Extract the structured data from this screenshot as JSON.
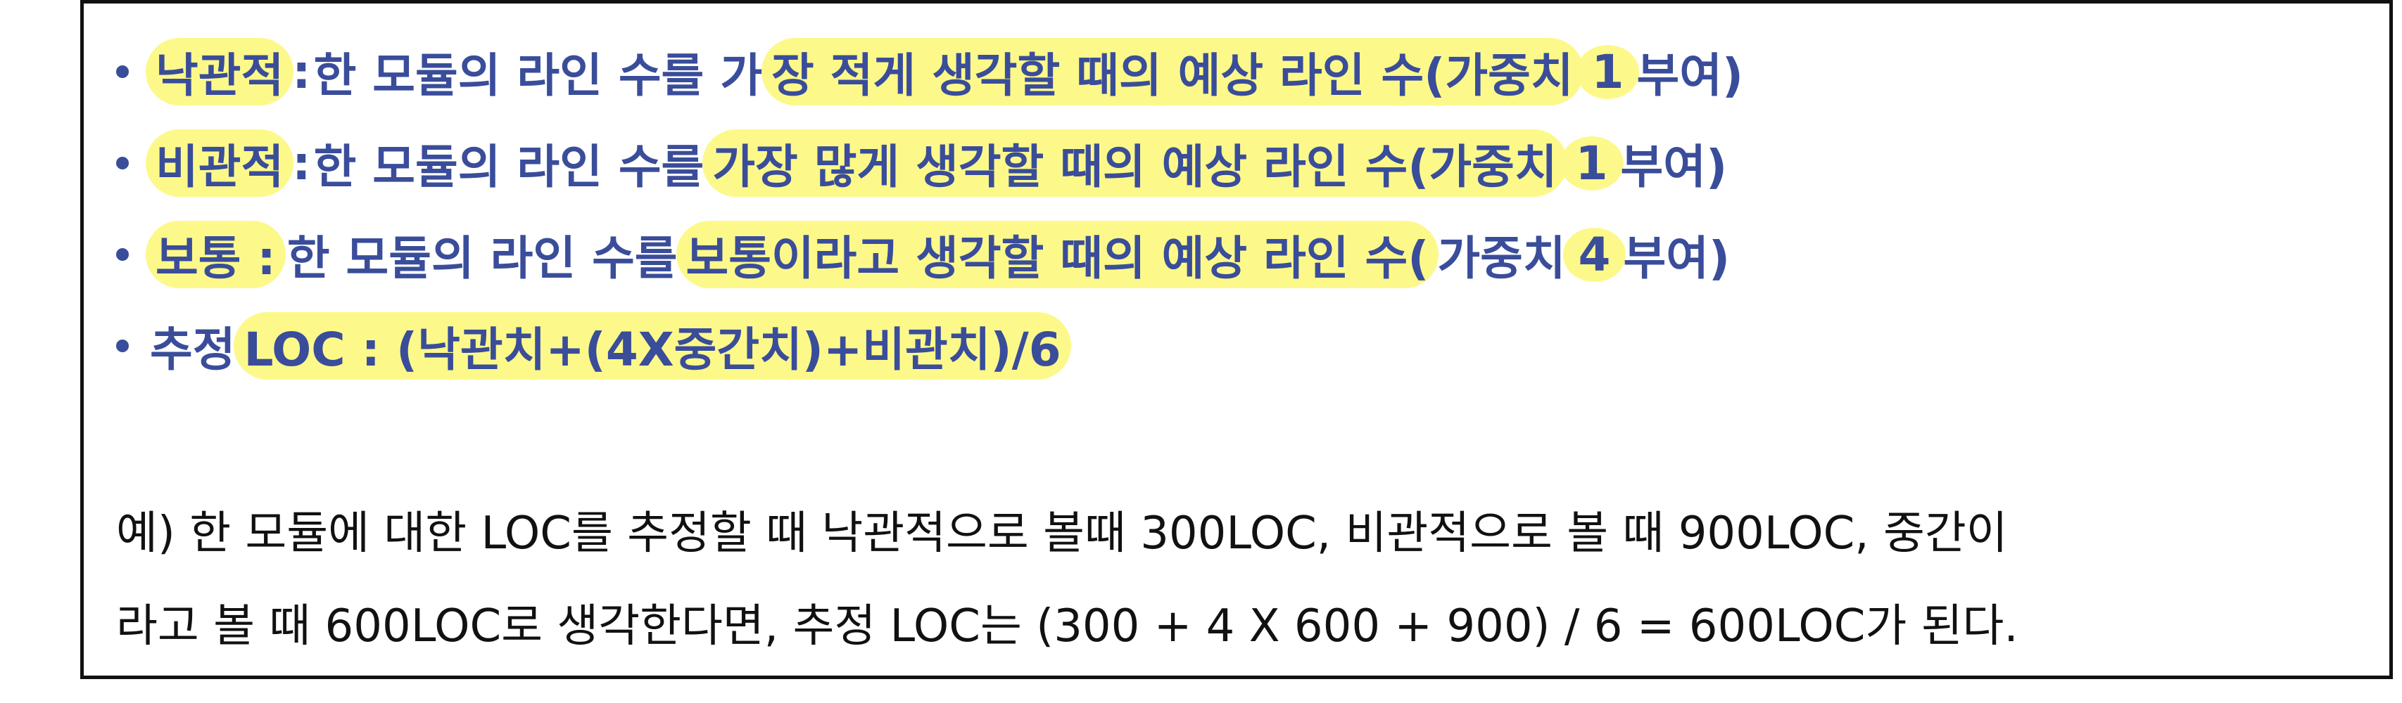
{
  "bullets": [
    {
      "term": "낙관적",
      "sep": " :  ",
      "text_a": "한 모듈의 라인 수를 가",
      "text_hl": "장 적게 생각할 때의 예상 라인 수(가중치 ",
      "weight": "1",
      "text_end": " 부여)"
    },
    {
      "term": "비관적",
      "sep": " : ",
      "text_a": "한 모듈의 라인 수를 ",
      "text_hl": "가장 많게 생각할 때의 예상 라인 수(가중치 ",
      "weight": "1",
      "text_end": " 부여)"
    },
    {
      "term": "보통 :",
      "sep": " ",
      "text_a": "한 모듈의 라인 수를 ",
      "text_hl": "보통이라고 생각할 때의 예상 라인 수(",
      "text_hl_plain": "가중치 ",
      "weight": "4",
      "text_end": " 부여)"
    },
    {
      "term": "추정 ",
      "formula": "LOC : (낙관치+(4X중간치)+비관치)/6"
    }
  ],
  "example": {
    "line1": "예) 한 모듈에 대한 LOC를 추정할 때 낙관적으로 볼때 300LOC, 비관적으로 볼 때 900LOC, 중간이",
    "line2": "라고 볼 때 600LOC로 생각한다면, 추정 LOC는 (300 + 4 X 600 + 900) / 6 = 600LOC가 된다."
  },
  "colors": {
    "text_blue": "#3a4d9a",
    "highlight": "#fcf98a",
    "border": "#111111"
  }
}
